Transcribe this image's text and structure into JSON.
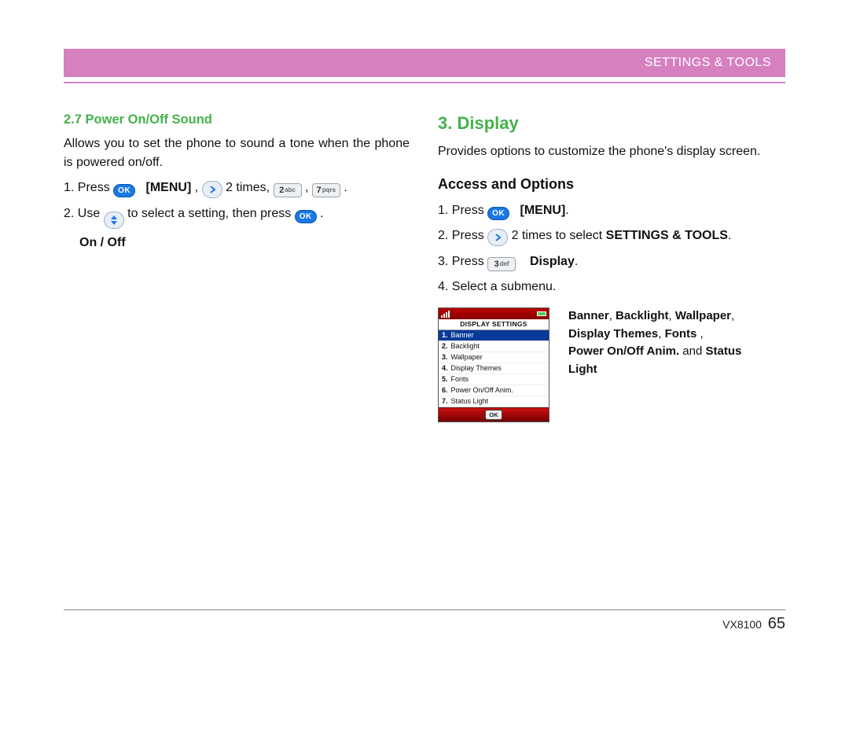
{
  "header": {
    "section": "SETTINGS & TOOLS"
  },
  "left": {
    "heading": "2.7 Power On/Off Sound",
    "desc": "Allows you to set the phone to sound a tone when the phone is powered on/off.",
    "step1_a": "1.  Press ",
    "step1_menu": "[MENU]",
    "step1_comma": ", ",
    "step1_times": " 2 times, ",
    "step1_commadot": " , ",
    "step1_end": " .",
    "step2_a": "2.  Use ",
    "step2_b": " to select a setting, then press ",
    "step2_end": " .",
    "onoff": "On / Off"
  },
  "icons": {
    "ok": "OK",
    "key2": {
      "n": "2",
      "l": "abc"
    },
    "key7": {
      "n": "7",
      "l": "pqrs"
    },
    "key3": {
      "n": "3",
      "l": "def"
    }
  },
  "right": {
    "heading": "3. Display",
    "desc": "Provides options to customize the phone's display screen.",
    "subhead": "Access and Options",
    "s1a": "1.  Press ",
    "s1menu": "[MENU]",
    "s1end": ".",
    "s2a": "2.  Press ",
    "s2b": " 2 times to select ",
    "s2c": "SETTINGS & TOOLS",
    "s2end": ".",
    "s3a": "3.  Press ",
    "s3b": "Display",
    "s3end": ".",
    "s4": "4.  Select a submenu.",
    "submenus_html_parts": {
      "p1": "Banner",
      "c": ", ",
      "p2": "Backlight",
      "p3": "Wallpaper",
      "p4": "Display Themes",
      "p5": "Fonts",
      "sp": " ,",
      "p6": "Power On/Off Anim.",
      "and": " and ",
      "p7": "Status Light"
    }
  },
  "phone": {
    "title": "DISPLAY SETTINGS",
    "items": [
      {
        "n": "1.",
        "label": "Banner"
      },
      {
        "n": "2.",
        "label": "Backlight"
      },
      {
        "n": "3.",
        "label": "Wallpaper"
      },
      {
        "n": "4.",
        "label": "Display Themes"
      },
      {
        "n": "5.",
        "label": "Fonts"
      },
      {
        "n": "6.",
        "label": "Power On/Off Anim."
      },
      {
        "n": "7.",
        "label": "Status Light"
      }
    ],
    "ok": "OK"
  },
  "footer": {
    "model": "VX8100",
    "page": "65"
  }
}
